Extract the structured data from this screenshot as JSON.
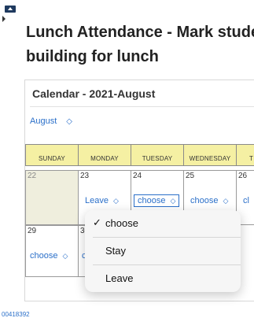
{
  "page": {
    "title_line1": "Lunch Attendance - Mark stude",
    "title_line2": "building for lunch"
  },
  "calendar": {
    "title": "Calendar - 2021-August",
    "month": "August",
    "weekdays": [
      "Sunday",
      "Monday",
      "Tuesday",
      "Wednesday",
      "T"
    ],
    "week1": [
      {
        "day": "22",
        "value": ""
      },
      {
        "day": "23",
        "value": "Leave"
      },
      {
        "day": "24",
        "value": "choose"
      },
      {
        "day": "25",
        "value": "choose"
      },
      {
        "day": "26",
        "value": "cl"
      }
    ],
    "week2": [
      {
        "day": "29",
        "value": "choose"
      },
      {
        "day": "30",
        "value": "c"
      }
    ]
  },
  "menu": {
    "options": [
      "choose",
      "Stay",
      "Leave"
    ],
    "selected": "choose"
  },
  "footer": {
    "id_text": "00418392"
  },
  "colors": {
    "accent": "#2a6fc9",
    "header_fill": "#f5f0a3",
    "today_fill": "#efeedd"
  }
}
